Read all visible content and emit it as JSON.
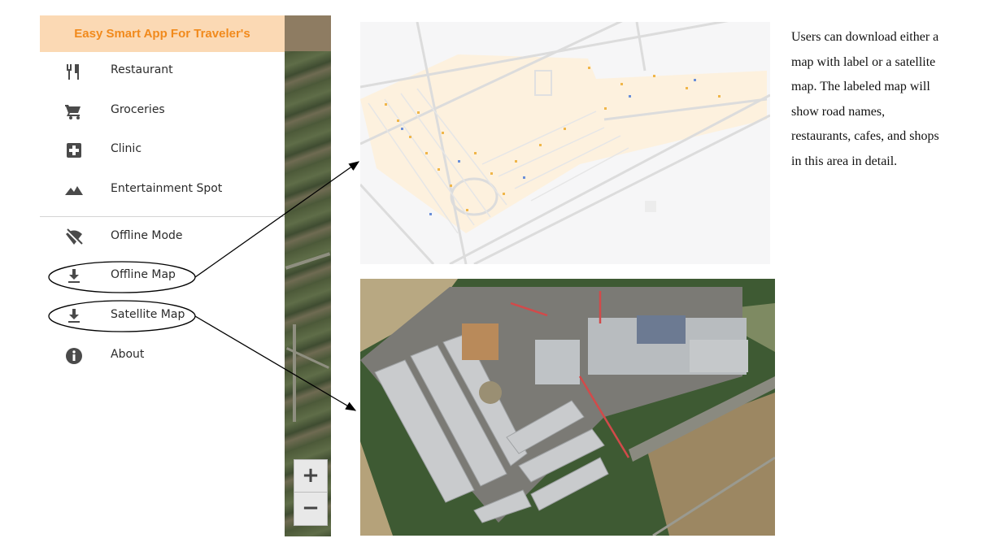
{
  "app": {
    "title": "Easy Smart App For Traveler's",
    "colors": {
      "header_bg": "#fbd9b4",
      "header_text": "#f18a1c",
      "icon": "#4a4a4a"
    }
  },
  "menu": {
    "items": [
      {
        "label": "Restaurant",
        "icon": "restaurant-icon"
      },
      {
        "label": "Groceries",
        "icon": "shopping-cart-icon"
      },
      {
        "label": "Clinic",
        "icon": "medical-cross-icon"
      },
      {
        "label": "Entertainment Spot",
        "icon": "mountain-icon"
      }
    ],
    "secondary_items": [
      {
        "label": "Offline Mode",
        "icon": "wifi-off-icon"
      },
      {
        "label": "Offline Map",
        "icon": "download-icon"
      },
      {
        "label": "Satellite Map",
        "icon": "download-icon"
      },
      {
        "label": "About",
        "icon": "info-icon"
      }
    ]
  },
  "zoom": {
    "in_label": "+",
    "out_label": "−"
  },
  "description": {
    "lines": [
      "Users can download either a",
      "map with label or a satellite",
      "map. The labeled map will",
      "show road names,",
      "restaurants, cafes, and shops",
      "in this area in detail."
    ]
  }
}
